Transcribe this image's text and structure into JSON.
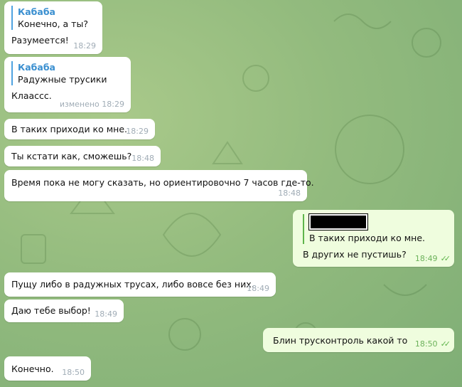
{
  "messages": [
    {
      "reply_name": "Кабаба",
      "reply_text": "Конечно, а ты?",
      "text": "Разумеется!",
      "time": "18:29"
    },
    {
      "reply_name": "Кабаба",
      "reply_text": "Радужные трусики",
      "text": "Клаассс.",
      "time": "изменено 18:29"
    },
    {
      "text": "В таких приходи ко мне.",
      "time": "18:29"
    },
    {
      "text": "Ты кстати как, сможешь?",
      "time": "18:48"
    },
    {
      "text": "Время пока не могу сказать, но ориентировочно 7 часов где-то.",
      "time": "18:48"
    },
    {
      "reply_text": "В таких приходи ко мне.",
      "text": "В других не пустишь?",
      "time": "18:49",
      "status": "read"
    },
    {
      "text": "Пущу либо в радужных трусах, либо вовсе без них.",
      "time": "18:49"
    },
    {
      "text": "Даю тебе выбор!",
      "time": "18:49"
    },
    {
      "text": "Блин трусконтроль какой то",
      "time": "18:50",
      "status": "read"
    },
    {
      "text": "Конечно.",
      "time": "18:50"
    }
  ],
  "colors": {
    "accent": "#3a8fd0",
    "outgoing_bubble": "#effdde",
    "read_check": "#5fb54b"
  }
}
